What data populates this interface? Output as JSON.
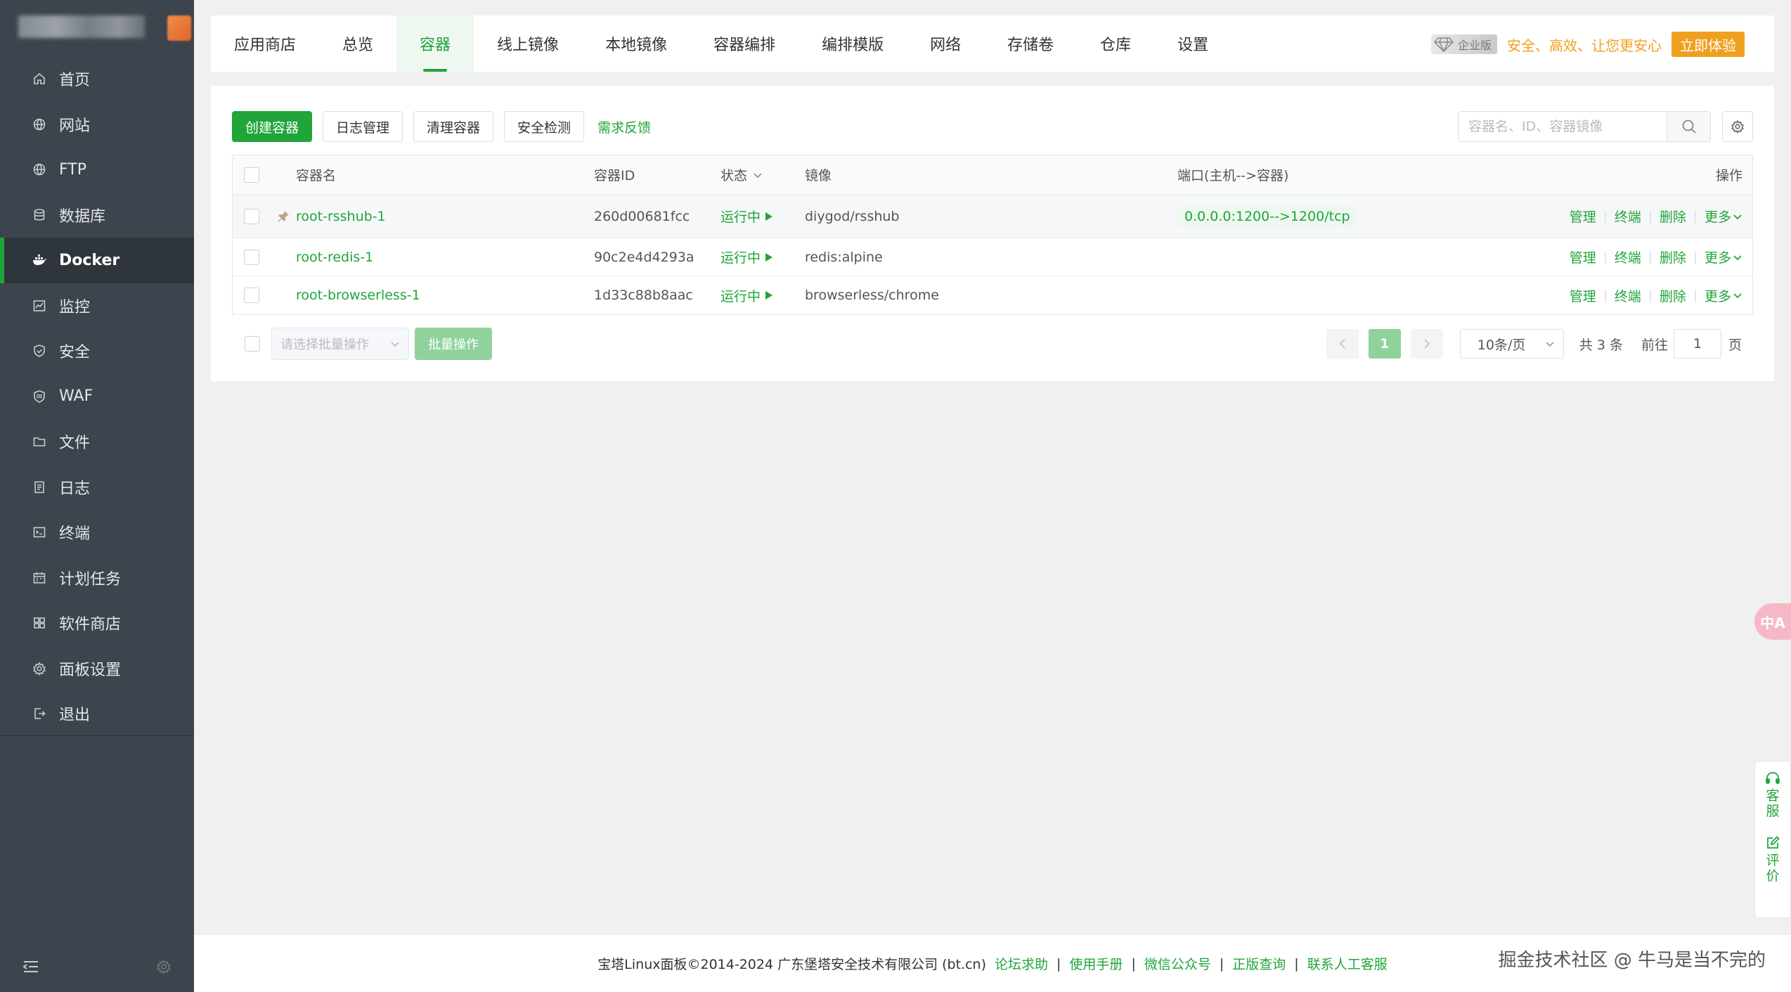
{
  "sidebar": {
    "items": [
      {
        "label": "首页",
        "icon": "home-icon"
      },
      {
        "label": "网站",
        "icon": "globe-icon"
      },
      {
        "label": "FTP",
        "icon": "globe-icon"
      },
      {
        "label": "数据库",
        "icon": "database-icon"
      },
      {
        "label": "Docker",
        "icon": "docker-icon"
      },
      {
        "label": "监控",
        "icon": "monitor-icon"
      },
      {
        "label": "安全",
        "icon": "shield-icon"
      },
      {
        "label": "WAF",
        "icon": "shield-icon"
      },
      {
        "label": "文件",
        "icon": "folder-icon"
      },
      {
        "label": "日志",
        "icon": "log-icon"
      },
      {
        "label": "终端",
        "icon": "terminal-icon"
      },
      {
        "label": "计划任务",
        "icon": "calendar-icon"
      },
      {
        "label": "软件商店",
        "icon": "grid-icon"
      },
      {
        "label": "面板设置",
        "icon": "gear-icon"
      },
      {
        "label": "退出",
        "icon": "logout-icon"
      }
    ],
    "active_index": 4
  },
  "tabs": [
    {
      "label": "应用商店"
    },
    {
      "label": "总览"
    },
    {
      "label": "容器"
    },
    {
      "label": "线上镜像"
    },
    {
      "label": "本地镜像"
    },
    {
      "label": "容器编排"
    },
    {
      "label": "编排模版"
    },
    {
      "label": "网络"
    },
    {
      "label": "存储卷"
    },
    {
      "label": "仓库"
    },
    {
      "label": "设置"
    }
  ],
  "active_tab": 2,
  "promo": {
    "badge": "企业版",
    "text": "安全、高效、让您更安心",
    "button": "立即体验"
  },
  "toolbar": {
    "create": "创建容器",
    "logs": "日志管理",
    "clean": "清理容器",
    "security": "安全检测",
    "feedback": "需求反馈",
    "search_placeholder": "容器名、ID、容器镜像"
  },
  "table": {
    "headers": {
      "name": "容器名",
      "id": "容器ID",
      "status": "状态",
      "image": "镜像",
      "port": "端口(主机-->容器)",
      "ops": "操作"
    },
    "rows": [
      {
        "name": "root-rsshub-1",
        "id": "260d00681fcc",
        "status": "运行中",
        "image": "diygod/rsshub",
        "port": "0.0.0.0:1200-->1200/tcp",
        "pinned": true
      },
      {
        "name": "root-redis-1",
        "id": "90c2e4d4293a",
        "status": "运行中",
        "image": "redis:alpine",
        "port": "",
        "pinned": false
      },
      {
        "name": "root-browserless-1",
        "id": "1d33c88b8aac",
        "status": "运行中",
        "image": "browserless/chrome",
        "port": "",
        "pinned": false
      }
    ],
    "ops": {
      "manage": "管理",
      "terminal": "终端",
      "delete": "删除",
      "more": "更多"
    }
  },
  "batch": {
    "select_placeholder": "请选择批量操作",
    "button": "批量操作"
  },
  "pager": {
    "current": "1",
    "size": "10条/页",
    "total": "共 3 条",
    "goto": "前往",
    "goto_value": "1",
    "page_suffix": "页"
  },
  "footer": {
    "copyright": "宝塔Linux面板©2014-2024 广东堡塔安全技术有限公司 (bt.cn)",
    "links": [
      "论坛求助",
      "使用手册",
      "微信公众号",
      "正版查询",
      "联系人工客服"
    ],
    "separator": "|"
  },
  "watermark": "掘金技术社区 @ 牛马是当不完的",
  "float": {
    "translate": "中A",
    "service": "客服",
    "review": "评价"
  },
  "colors": {
    "accent": "#20a53a",
    "sidebar_bg": "#3c444d",
    "promo": "#f0a020"
  }
}
